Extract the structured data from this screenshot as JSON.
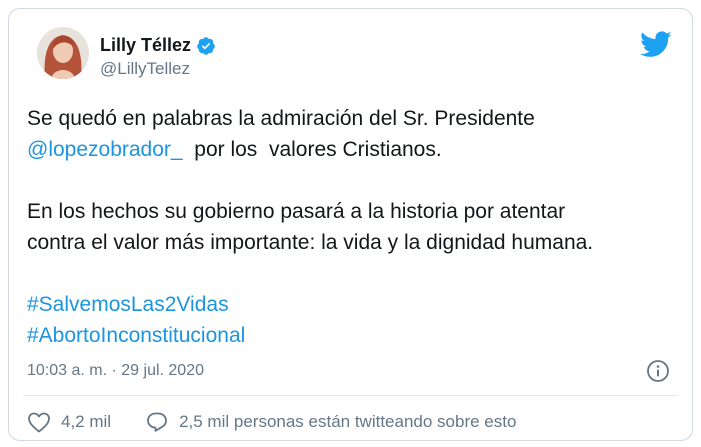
{
  "user": {
    "display_name": "Lilly Téllez",
    "handle": "@LillyTellez"
  },
  "tweet": {
    "line1": "Se quedó en palabras la admiración del Sr. Presidente",
    "mention": "@lopezobrador_",
    "line2_rest": "  por los  valores Cristianos.",
    "paragraph2_line1": "En los hechos su gobierno pasará a la historia por atentar",
    "paragraph2_line2": "contra el valor más importante: la vida y la dignidad humana.",
    "hashtags": [
      "#SalvemosLas2Vidas",
      "#AbortoInconstitucional"
    ]
  },
  "meta": {
    "timestamp": "10:03 a. m. · 29 jul. 2020"
  },
  "actions": {
    "likes": "4,2 mil",
    "conversation": "2,5 mil personas están twitteando sobre esto"
  },
  "colors": {
    "link": "#1b95e0",
    "verified": "#1da1f2",
    "twitter_brand": "#1da1f2",
    "secondary_text": "#657786"
  },
  "icons": [
    "verified-icon",
    "twitter-logo-icon",
    "info-icon",
    "heart-icon",
    "conversation-icon"
  ]
}
